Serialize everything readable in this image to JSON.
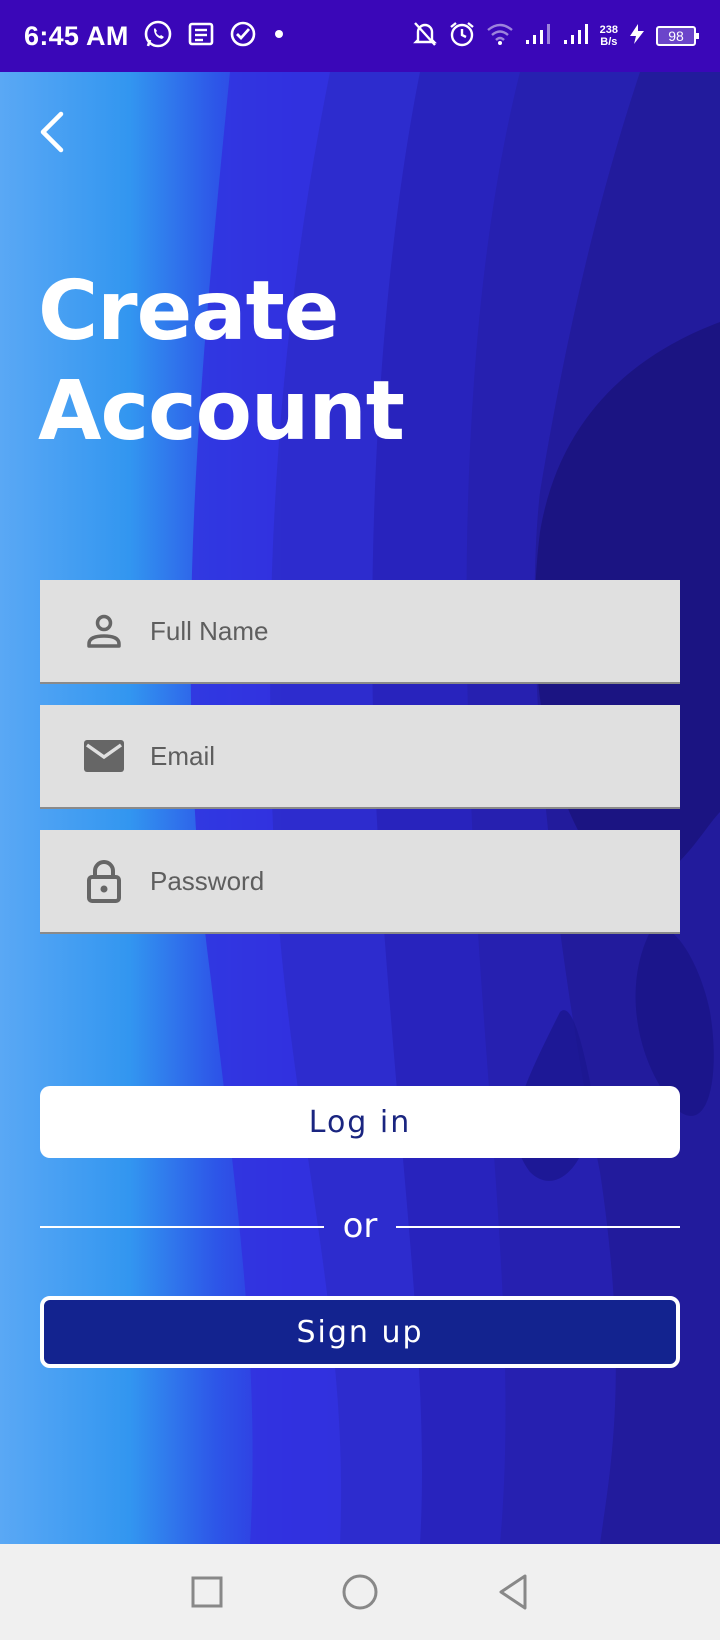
{
  "status_bar": {
    "time": "6:45 AM",
    "net_speed_value": "238",
    "net_speed_unit": "B/s",
    "battery": "98"
  },
  "header": {
    "back_icon": "chevron-left-icon",
    "title_line1": "Create",
    "title_line2": "Account"
  },
  "form": {
    "full_name": {
      "placeholder": "Full Name",
      "value": "",
      "icon": "person-icon"
    },
    "email": {
      "placeholder": "Email",
      "value": "",
      "icon": "mail-icon"
    },
    "password": {
      "placeholder": "Password",
      "value": "",
      "icon": "lock-icon"
    }
  },
  "actions": {
    "login_label": "Log in",
    "or_label": "or",
    "signup_label": "Sign up"
  },
  "colors": {
    "status_bar": "#3a07b8",
    "field_bg": "#e0e0e0",
    "login_text": "#1a2580",
    "signup_bg": "#13238f"
  }
}
